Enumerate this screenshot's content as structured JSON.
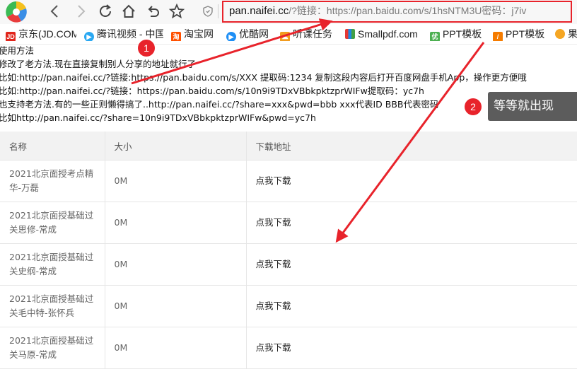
{
  "browser": {
    "address_domain": "pan.naifei.cc",
    "address_rest": "/?链接：https://pan.baidu.com/s/1hsNTM3U密码：j7iv"
  },
  "bookmarks": [
    {
      "label": "京东(JD.COM)",
      "icon": "jd-icon",
      "color": "#e1251b",
      "glyph": "JD"
    },
    {
      "label": "腾讯视频 - 中国领先",
      "icon": "tencent-video-icon",
      "color": "#2aa8f2",
      "glyph": "▶"
    },
    {
      "label": "淘宝网",
      "icon": "taobao-icon",
      "color": "#ff5000",
      "glyph": "淘"
    },
    {
      "label": "优酷网",
      "icon": "youku-icon",
      "color": "#1f8ff5",
      "glyph": "▶"
    },
    {
      "label": "听课任务",
      "icon": "course-icon",
      "color": "#f29c1f",
      "glyph": "☁"
    },
    {
      "label": "Smallpdf.com",
      "icon": "smallpdf-icon",
      "color": "#e53935",
      "glyph": "▦"
    },
    {
      "label": "PPT模板",
      "icon": "youppt-icon",
      "color": "#4caf50",
      "glyph": "优"
    },
    {
      "label": "PPT模板",
      "icon": "ppt-template-icon",
      "color": "#f57c00",
      "glyph": "/"
    },
    {
      "label": "果",
      "icon": "fruit-icon",
      "color": "#f5a623",
      "glyph": "●"
    }
  ],
  "instructions": [
    "使用方法",
    "修改了老方法.现在直接复制别人分享的地址就行了",
    "比如:http://pan.naifei.cc/?链接:https://pan.baidu.com/s/XXX 提取码:1234 复制这段内容后打开百度网盘手机App，操作更方便哦",
    "比如:http://pan.naifei.cc/?链接：https://pan.baidu.com/s/10n9i9TDxVBbkpktzprWIFw提取码：yc7h",
    "也支持老方法.有的一些正则懒得搞了..http://pan.naifei.cc/?share=xxx&pwd=bbb xxx代表ID BBB代表密码",
    "比如http://pan.naifei.cc/?share=10n9i9TDxVBbkpktzprWIFw&pwd=yc7h"
  ],
  "table": {
    "headers": [
      "名称",
      "大小",
      "下载地址"
    ],
    "rows": [
      {
        "name": "2021北京面授考点精华-万磊",
        "size": "0M",
        "link": "点我下载"
      },
      {
        "name": "2021北京面授基础过关思修-常成",
        "size": "0M",
        "link": "点我下载"
      },
      {
        "name": "2021北京面授基础过关史纲-常成",
        "size": "0M",
        "link": "点我下载"
      },
      {
        "name": "2021北京面授基础过关毛中特-张怀兵",
        "size": "0M",
        "link": "点我下载"
      },
      {
        "name": "2021北京面授基础过关马原-常成",
        "size": "0M",
        "link": "点我下载"
      }
    ]
  },
  "annotations": {
    "badge1": "1",
    "badge2": "2",
    "tooltip": "等等就出现",
    "accent_color": "#e8232b"
  }
}
